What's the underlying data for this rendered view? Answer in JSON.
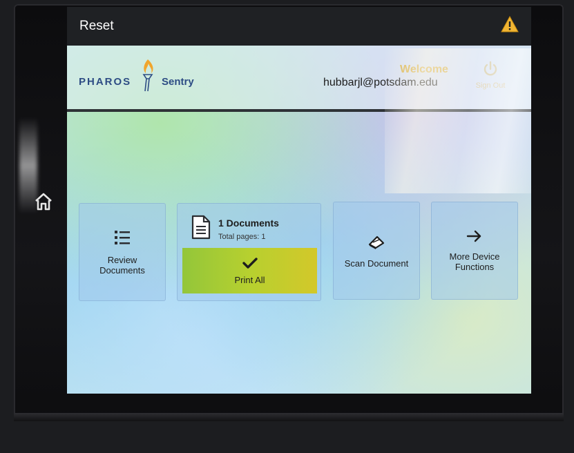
{
  "topbar": {
    "reset_label": "Reset",
    "warning_icon": "warning-triangle-icon"
  },
  "header": {
    "brand_name": "PHAROS",
    "product_name": "Sentry",
    "user_email": "hubbarjl@potsdam.edu",
    "welcome_text": "Welcome",
    "signout_label": "Sign Out"
  },
  "tiles": {
    "review": {
      "label_line1": "Review",
      "label_line2": "Documents",
      "icon": "list-icon"
    },
    "print": {
      "doc_count": "1 Documents",
      "total_pages": "Total pages: 1",
      "print_all_label": "Print All",
      "icon": "document-icon"
    },
    "scan": {
      "label": "Scan Document",
      "icon": "scanner-icon"
    },
    "more": {
      "label_line1": "More Device",
      "label_line2": "Functions",
      "icon": "arrow-right-icon"
    }
  },
  "device": {
    "home_icon": "home-icon"
  },
  "colors": {
    "topbar": "#1f2124",
    "brand": "#2d4c84",
    "print_button_start": "#93c63a",
    "print_button_end": "#d3c82a",
    "warning": "#f1b533"
  }
}
